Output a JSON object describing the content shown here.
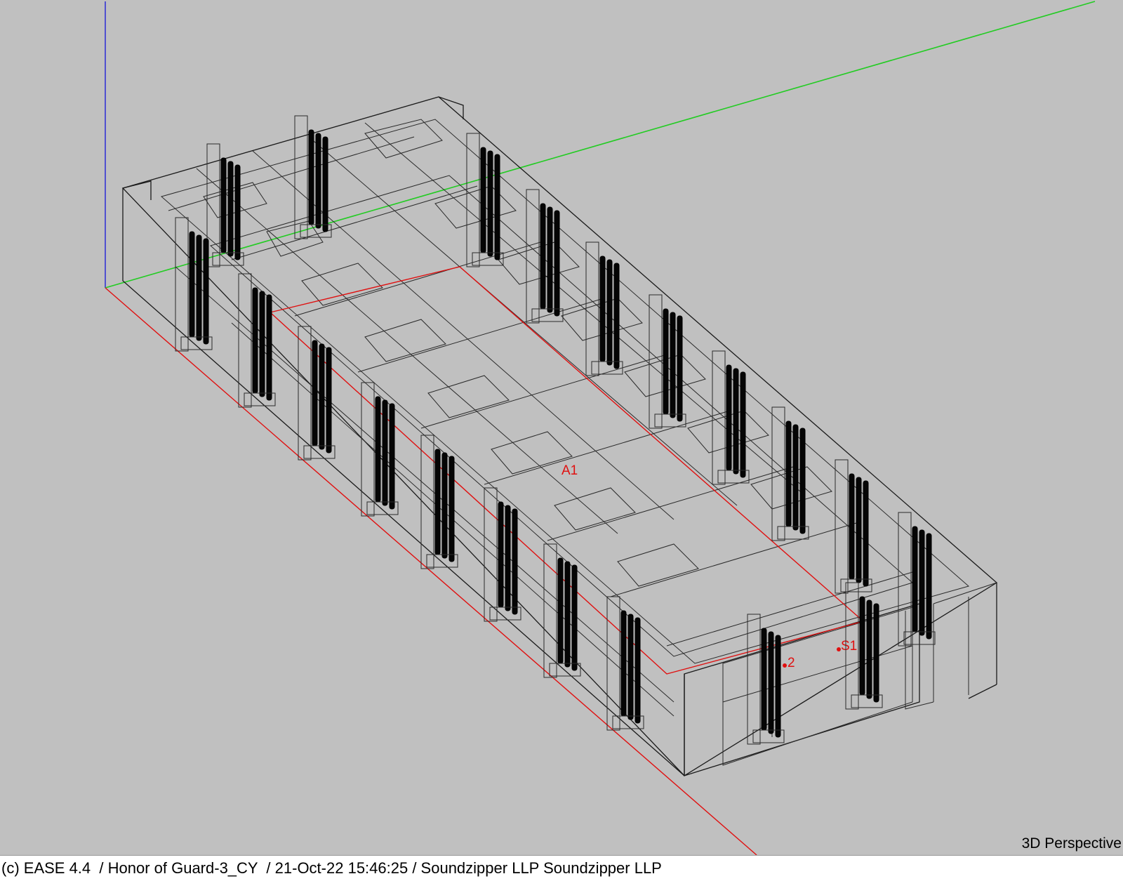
{
  "viewport": {
    "view_mode": "3D Perspective",
    "labels": {
      "audience_area": "A1",
      "source_1": "S1",
      "source_2": "2"
    },
    "colors": {
      "background": "#c0c0c0",
      "x_axis": "#e01010",
      "y_axis": "#22cc22",
      "z_axis": "#5050d0",
      "wireframe": "#1a1a1a"
    }
  },
  "statusbar": {
    "text": "(c) EASE 4.4  / Honor of Guard-3_CY  / 21-Oct-22 15:46:25 / Soundzipper LLP Soundzipper LLP"
  }
}
